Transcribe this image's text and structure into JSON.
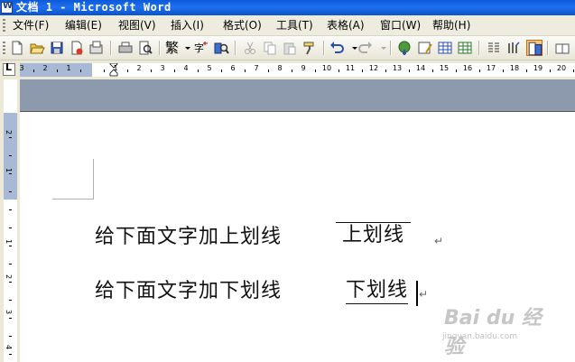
{
  "window": {
    "title": "文档 1 - Microsoft Word"
  },
  "menu": {
    "items": [
      {
        "label": "文件(F)"
      },
      {
        "label": "编辑(E)"
      },
      {
        "label": "视图(V)"
      },
      {
        "label": "插入(I)"
      },
      {
        "label": "格式(O)"
      },
      {
        "label": "工具(T)"
      },
      {
        "label": "表格(A)"
      },
      {
        "label": "窗口(W)"
      },
      {
        "label": "帮助(H)"
      }
    ]
  },
  "toolbar": {
    "traditional_label": "繁",
    "icons": [
      "new-icon",
      "open-icon",
      "save-icon",
      "permission-icon",
      "email-icon",
      "print-icon",
      "print-preview-icon",
      "traditional-chinese-icon",
      "simplified-conversion-icon",
      "research-icon",
      "cut-icon",
      "copy-icon",
      "paste-icon",
      "format-painter-icon",
      "undo-icon",
      "redo-icon",
      "hyperlink-icon",
      "tables-borders-icon",
      "insert-table-icon",
      "insert-excel-icon",
      "columns-icon",
      "drawing-icon",
      "document-map-icon",
      "read-icon"
    ]
  },
  "ruler": {
    "labels": [
      "3",
      "2",
      "1",
      "1",
      "2",
      "3",
      "4",
      "5",
      "6",
      "7",
      "8",
      "9",
      "10",
      "11",
      "12",
      "13",
      "14",
      "15",
      "16",
      "17",
      "18",
      "19",
      "20"
    ],
    "vertical_labels": [
      "2",
      "1",
      "1",
      "2",
      "3",
      "4"
    ],
    "tab_selector": "L"
  },
  "document": {
    "line1": {
      "text": "给下面文字加上划线",
      "styled": "上划线",
      "style": "overline"
    },
    "line2": {
      "text": "给下面文字加下划线",
      "styled": "下划线",
      "style": "underline"
    },
    "paragraph_mark": "↵"
  },
  "watermark": {
    "brand": "Bai du 经验",
    "url": "jingyan.baidu.com"
  }
}
